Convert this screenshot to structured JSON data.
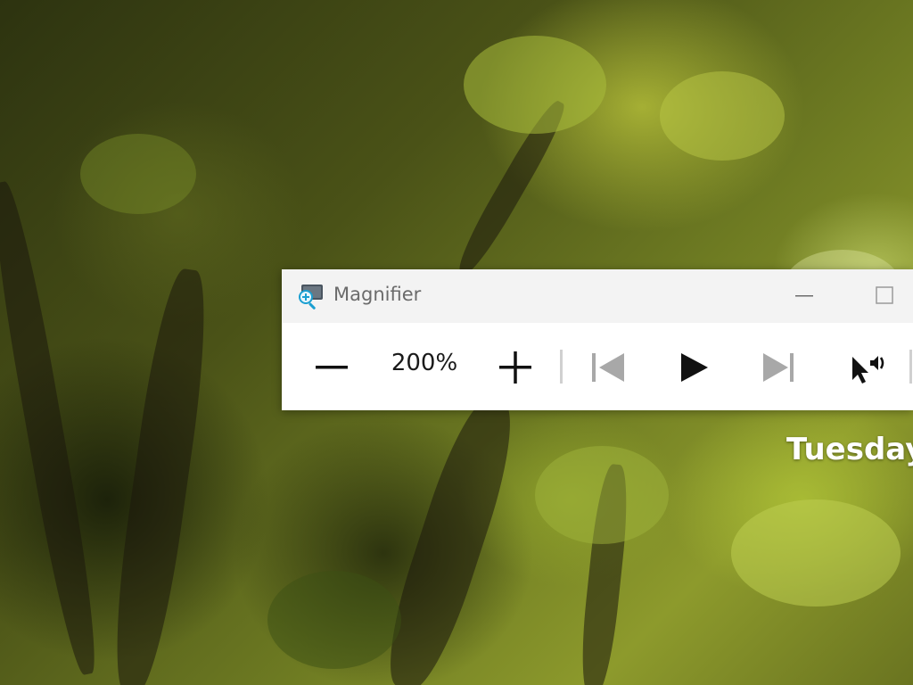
{
  "desktop": {
    "date_text": "Tuesday"
  },
  "magnifier": {
    "title": "Magnifier",
    "zoom_level": "200%",
    "icons": {
      "app": "magnifier-app-icon",
      "minimize": "minimize-icon",
      "maximize": "maximize-icon",
      "zoom_out": "minus-icon",
      "zoom_in": "plus-icon",
      "previous": "skip-previous-icon",
      "play": "play-icon",
      "next": "skip-next-icon",
      "read_from_here": "pointer-speaker-icon"
    },
    "colors": {
      "titlebar_bg": "#f3f3f3",
      "accent": "#1a9fd1",
      "disabled_icon": "#a8a8a8",
      "icon": "#111111"
    }
  }
}
